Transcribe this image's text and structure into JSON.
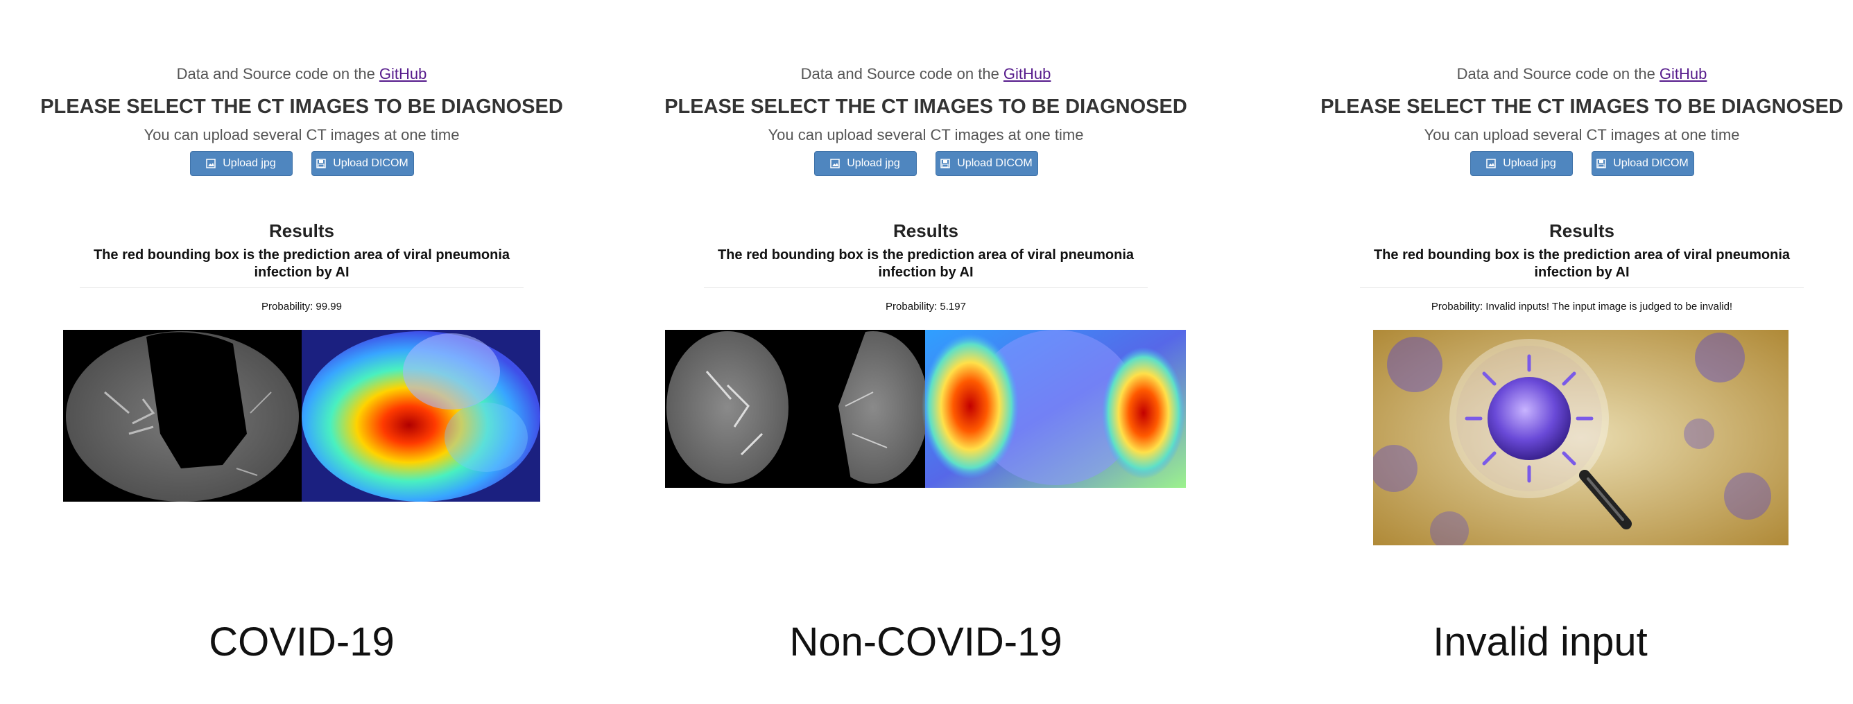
{
  "panels": [
    {
      "source_prefix": "Data and Source code on the ",
      "source_link": "GitHub",
      "heading": "PLEASE SELECT THE CT IMAGES TO BE DIAGNOSED",
      "subtext": "You can upload several CT images at one time",
      "upload_jpg_label": "Upload jpg",
      "upload_dicom_label": "Upload DICOM",
      "results_title": "Results",
      "results_description": "The red bounding box is the prediction area of viral pneumonia infection by AI",
      "probability": "Probability: 99.99",
      "caption": "COVID-19"
    },
    {
      "source_prefix": "Data and Source code on the ",
      "source_link": "GitHub",
      "heading": "PLEASE SELECT THE CT IMAGES TO BE DIAGNOSED",
      "subtext": "You can upload several CT images at one time",
      "upload_jpg_label": "Upload jpg",
      "upload_dicom_label": "Upload DICOM",
      "results_title": "Results",
      "results_description": "The red bounding box is the prediction area of viral pneumonia infection by AI",
      "probability": "Probability: 5.197",
      "caption": "Non-COVID-19"
    },
    {
      "source_prefix": "Data and Source code on the ",
      "source_link": "GitHub",
      "heading": "PLEASE SELECT THE CT IMAGES TO BE DIAGNOSED",
      "subtext": "You can upload several CT images at one time",
      "upload_jpg_label": "Upload jpg",
      "upload_dicom_label": "Upload DICOM",
      "results_title": "Results",
      "results_description": "The red bounding box is the prediction area of viral pneumonia infection by AI",
      "probability": "Probability: Invalid inputs! The input image is judged to be invalid!",
      "caption": "Invalid input"
    }
  ],
  "icons": {
    "jpg": "image-icon",
    "dicom": "file-icon"
  },
  "colors": {
    "button": "#4f86bf",
    "link": "#551a8b",
    "text": "#333333"
  }
}
